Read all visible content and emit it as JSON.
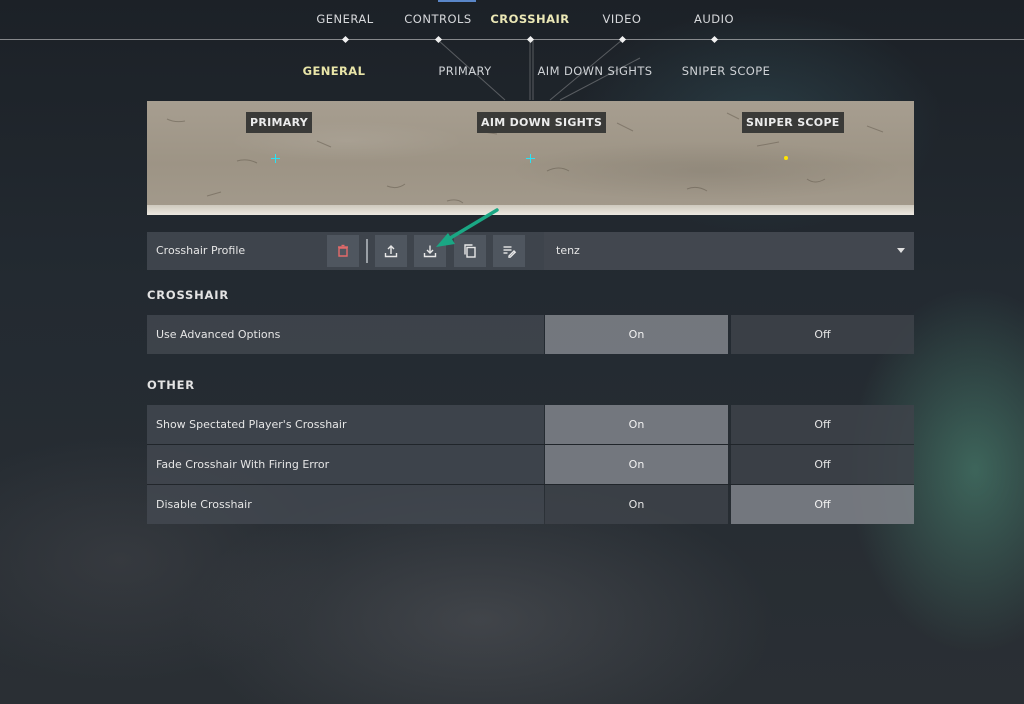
{
  "nav": {
    "tabs": [
      {
        "label": "GENERAL"
      },
      {
        "label": "CONTROLS"
      },
      {
        "label": "CROSSHAIR"
      },
      {
        "label": "VIDEO"
      },
      {
        "label": "AUDIO"
      }
    ],
    "active_tab": "CROSSHAIR",
    "subtabs": [
      {
        "label": "GENERAL"
      },
      {
        "label": "PRIMARY"
      },
      {
        "label": "AIM DOWN SIGHTS"
      },
      {
        "label": "SNIPER SCOPE"
      }
    ],
    "active_subtab": "GENERAL"
  },
  "preview": {
    "labels": [
      "PRIMARY",
      "AIM DOWN SIGHTS",
      "SNIPER SCOPE"
    ],
    "crosshair_colors": [
      "#29e3f5",
      "#29e3f5",
      "#ffe400"
    ]
  },
  "profile": {
    "label": "Crosshair Profile",
    "buttons": [
      "trash-icon",
      "upload-icon",
      "download-icon",
      "copy-icon",
      "rename-icon"
    ],
    "selected": "tenz"
  },
  "sections": {
    "crosshair": {
      "title": "CROSSHAIR",
      "rows": [
        {
          "label": "Use Advanced Options",
          "on": "On",
          "off": "Off",
          "selected": "On"
        }
      ]
    },
    "other": {
      "title": "OTHER",
      "rows": [
        {
          "label": "Show Spectated Player's Crosshair",
          "on": "On",
          "off": "Off",
          "selected": "On"
        },
        {
          "label": "Fade Crosshair With Firing Error",
          "on": "On",
          "off": "Off",
          "selected": "On"
        },
        {
          "label": "Disable Crosshair",
          "on": "On",
          "off": "Off",
          "selected": "Off"
        }
      ]
    }
  },
  "colors": {
    "active_tab": "#ebe8b6",
    "annotation_arrow": "#1aa784"
  }
}
